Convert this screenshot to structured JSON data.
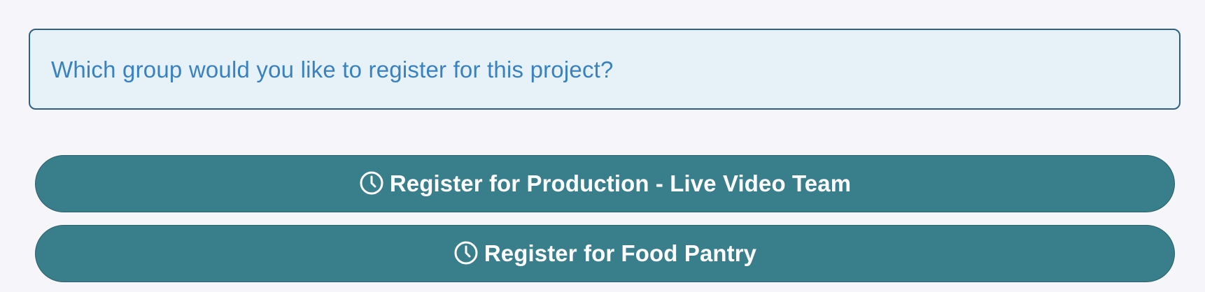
{
  "prompt": {
    "question": "Which group would you like to register for this project?"
  },
  "actions": {
    "buttons": [
      {
        "icon": "clock-icon",
        "label": "Register for Production - Live Video Team"
      },
      {
        "icon": "clock-icon",
        "label": "Register for Food Pantry"
      }
    ]
  },
  "colors": {
    "page_background": "#f6f6fa",
    "prompt_background": "#e6f2f8",
    "prompt_border": "#2f5f86",
    "prompt_text": "#3a82bf",
    "button_background": "#397f8b",
    "button_text": "#ffffff"
  }
}
